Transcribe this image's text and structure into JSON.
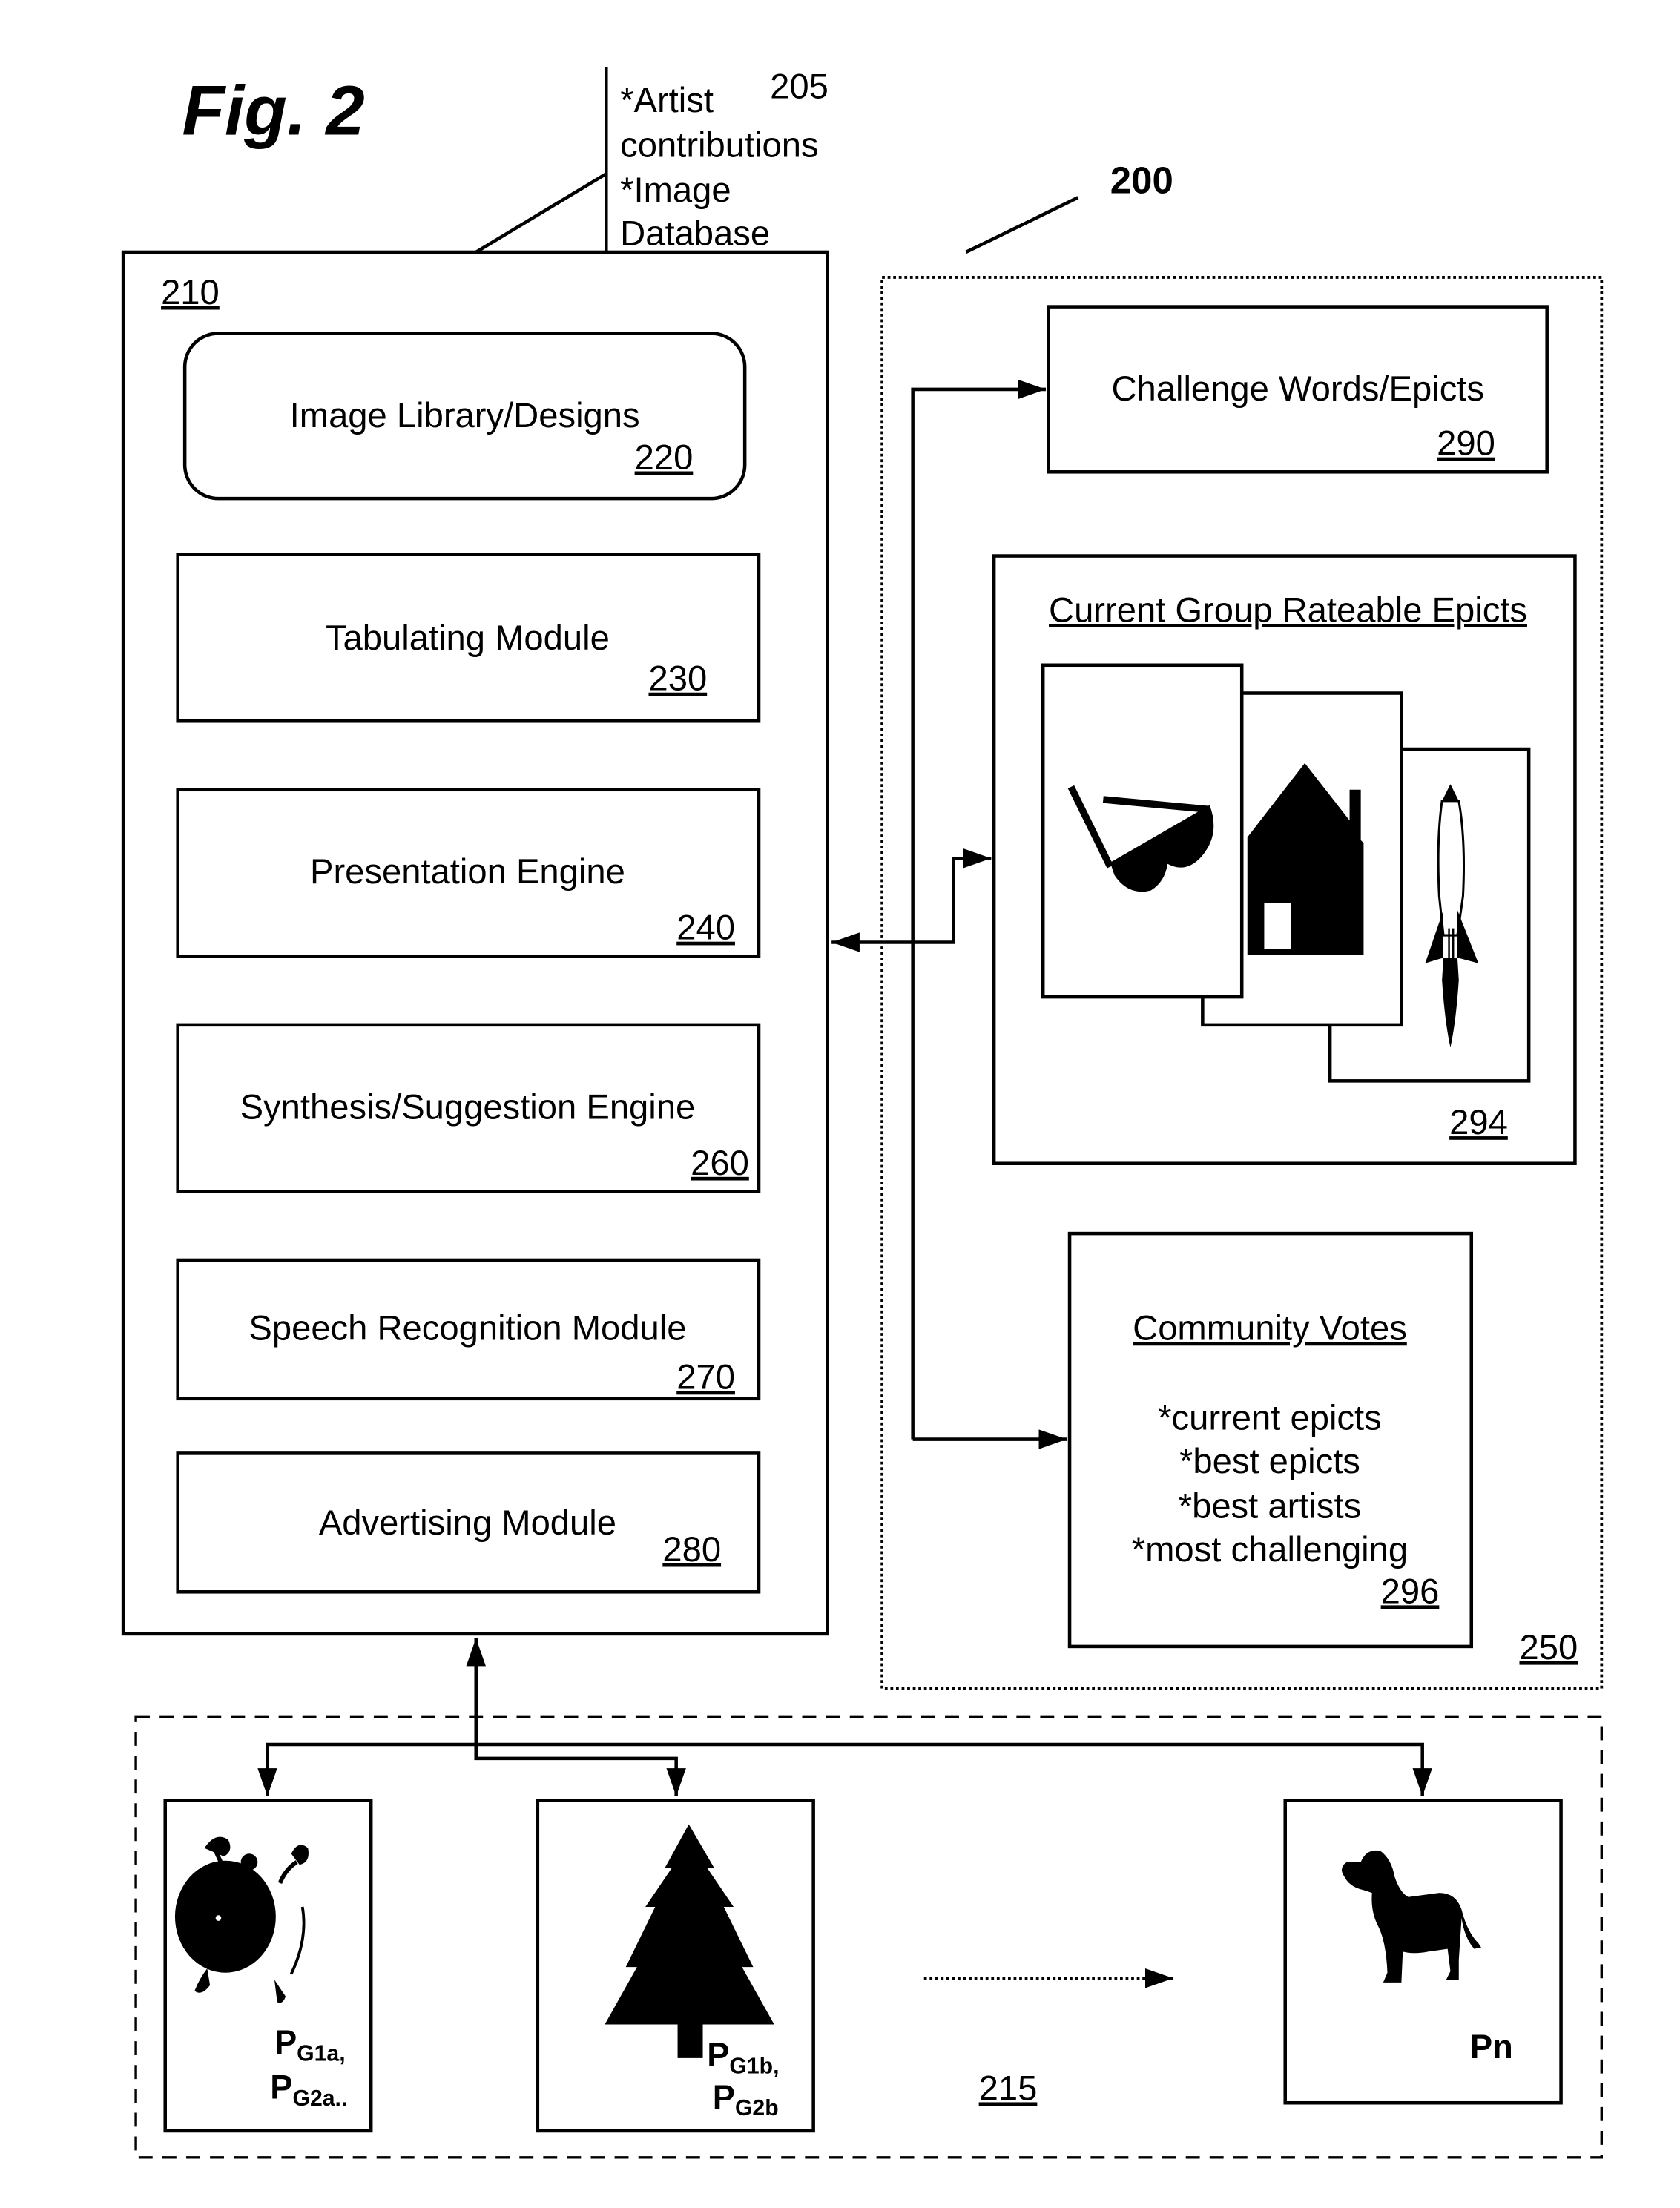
{
  "figure": {
    "title": "Fig. 2",
    "system_ref": "200"
  },
  "input_note": {
    "ref": "205",
    "lines": [
      "*Artist",
      "contributions",
      "*Image",
      "Database"
    ]
  },
  "server": {
    "ref": "210",
    "modules": [
      {
        "label": "Image Library/Designs",
        "ref": "220"
      },
      {
        "label": "Tabulating Module",
        "ref": "230"
      },
      {
        "label": "Presentation Engine",
        "ref": "240"
      },
      {
        "label": "Synthesis/Suggestion Engine",
        "ref": "260"
      },
      {
        "label": "Speech Recognition Module",
        "ref": "270"
      },
      {
        "label": "Advertising Module",
        "ref": "280"
      }
    ]
  },
  "community": {
    "ref": "250",
    "challenge": {
      "label": "Challenge Words/Epicts",
      "ref": "290"
    },
    "rateable": {
      "title": "Current Group Rateable Epicts",
      "ref": "294",
      "epicts": [
        "glasses-icon",
        "house-icon",
        "rocket-icon"
      ]
    },
    "votes": {
      "title": "Community Votes",
      "items": [
        "*current epicts",
        "*best epicts",
        "*best artists",
        "*most challenging"
      ],
      "ref": "296"
    }
  },
  "players": {
    "ref": "215",
    "cards": [
      {
        "icon": "alarm-clock-icon",
        "labels": [
          {
            "base": "P",
            "sub": "G1a,"
          },
          {
            "base": "P",
            "sub": "G2a.."
          }
        ]
      },
      {
        "icon": "pine-tree-icon",
        "labels": [
          {
            "base": "P",
            "sub": "G1b,"
          },
          {
            "base": "P",
            "sub": "G2b"
          }
        ]
      },
      {
        "icon": "dog-icon",
        "labels": [
          {
            "base": "Pn",
            "sub": ""
          }
        ]
      }
    ]
  }
}
